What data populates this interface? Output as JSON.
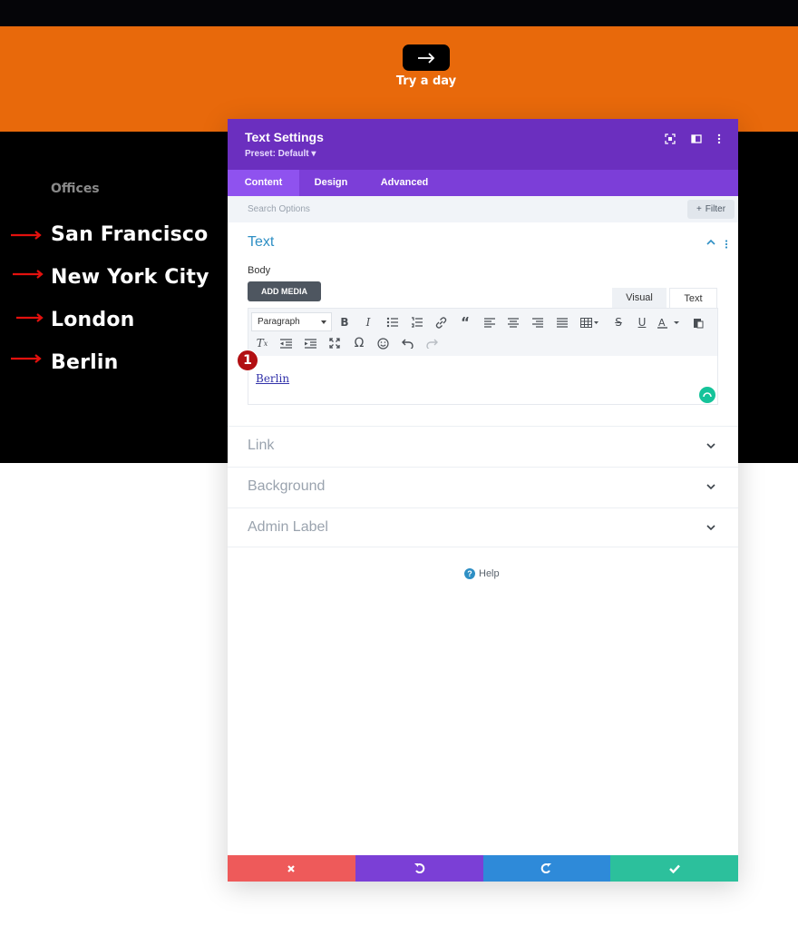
{
  "page": {
    "cta_label": "Try a day",
    "offices_heading": "Offices",
    "cities": [
      "San Francisco",
      "New York City",
      "London",
      "Berlin"
    ],
    "colors": {
      "orange": "#e8690b",
      "arrow": "#e3110e",
      "purple_header": "#6b2fbf",
      "purple_tabs": "#7c3ed8"
    }
  },
  "modal": {
    "title": "Text Settings",
    "preset": "Preset: Default",
    "preset_caret": "▾",
    "tabs": [
      "Content",
      "Design",
      "Advanced"
    ],
    "active_tab": "Content",
    "search_placeholder": "Search Options",
    "filter_label": "Filter",
    "text_section": {
      "title": "Text",
      "body_label": "Body",
      "add_media": "ADD MEDIA",
      "editor_tabs": [
        "Visual",
        "Text"
      ],
      "format_select": "Paragraph",
      "editor_content": "Berlin",
      "badge_number": "1",
      "icons_row1": [
        "bold-icon",
        "italic-icon",
        "bulleted-list-icon",
        "numbered-list-icon",
        "link-icon",
        "blockquote-icon",
        "align-left-icon",
        "align-center-icon",
        "align-right-icon",
        "align-justify-icon",
        "table-icon",
        "strikethrough-icon",
        "underline-icon",
        "text-color-icon",
        "paste-icon"
      ],
      "icons_row2": [
        "clear-format-icon",
        "outdent-icon",
        "indent-icon",
        "fullscreen-icon",
        "omega-icon",
        "emoji-icon",
        "undo-icon",
        "redo-icon"
      ]
    },
    "accordions": [
      "Link",
      "Background",
      "Admin Label"
    ],
    "help_label": "Help",
    "footer_colors": [
      "#ee5a5a",
      "#7b3fd6",
      "#2e8ad9",
      "#2cc09c"
    ]
  }
}
